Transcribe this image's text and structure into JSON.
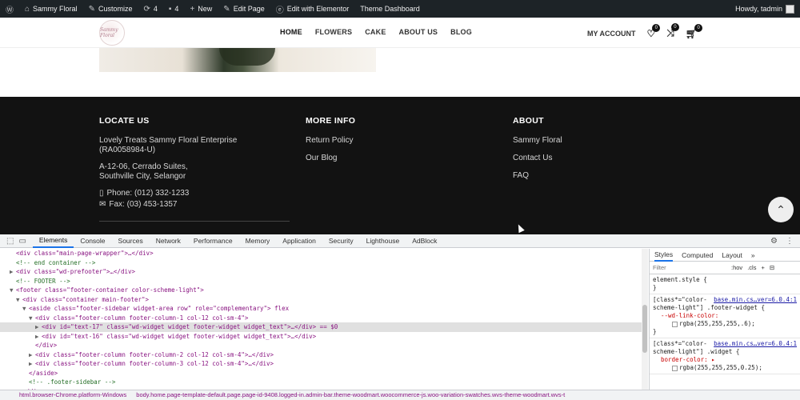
{
  "admin_bar": {
    "site_name": "Sammy Floral",
    "customize": "Customize",
    "updates": "4",
    "comments": "4",
    "new": "New",
    "edit_page": "Edit Page",
    "elementor": "Edit with Elementor",
    "theme_dashboard": "Theme Dashboard",
    "howdy": "Howdy, tadmin"
  },
  "header": {
    "logo_text": "Sammy Floral",
    "nav": [
      "HOME",
      "FLOWERS",
      "CAKE",
      "ABOUT US",
      "BLOG"
    ],
    "my_account": "MY ACCOUNT",
    "wishlist_count": "0",
    "compare_count": "0",
    "cart_count": "0"
  },
  "footer": {
    "locate_title": "LOCATE US",
    "company": "Lovely Treats Sammy Floral Enterprise (RA0058984-U)",
    "address": "A-12-06, Cerrado Suites, Southville City, Selangor",
    "phone": "Phone: (012) 332-1233",
    "fax": "Fax: (03) 453-1357",
    "more_title": "MORE INFO",
    "more_links": [
      "Return Policy",
      "Our Blog"
    ],
    "about_title": "ABOUT",
    "about_links": [
      "Sammy Floral",
      "Contact Us",
      "FAQ"
    ]
  },
  "devtools": {
    "tabs": [
      "Elements",
      "Console",
      "Sources",
      "Network",
      "Performance",
      "Memory",
      "Application",
      "Security",
      "Lighthouse",
      "AdBlock"
    ],
    "active_tab": "Elements",
    "styles_tabs": [
      "Styles",
      "Computed",
      "Layout",
      "»"
    ],
    "filter_placeholder": "Filter",
    "hov": ":hov",
    "cls": ".cls",
    "add": "+",
    "lines": [
      {
        "indent": 2,
        "arrow": "",
        "html": "<div class=\"main-page-wrapper\">…</div>",
        "kind": "tag"
      },
      {
        "indent": 2,
        "arrow": "",
        "html": "<!-- end container -->",
        "kind": "cmt"
      },
      {
        "indent": 2,
        "arrow": "▶",
        "html": "<div class=\"wd-prefooter\">…</div>",
        "kind": "tag"
      },
      {
        "indent": 2,
        "arrow": "",
        "html": "<!-- FOOTER -->",
        "kind": "cmt"
      },
      {
        "indent": 2,
        "arrow": "▼",
        "html": "<footer class=\"footer-container color-scheme-light\">",
        "kind": "tag"
      },
      {
        "indent": 4,
        "arrow": "▼",
        "html": "<div class=\"container main-footer\">",
        "kind": "tag"
      },
      {
        "indent": 6,
        "arrow": "▼",
        "html": "<aside class=\"footer-sidebar widget-area row\" role=\"complementary\"> flex",
        "kind": "tag"
      },
      {
        "indent": 8,
        "arrow": "▼",
        "html": "<div class=\"footer-column footer-column-1 col-12 col-sm-4\">",
        "kind": "tag"
      },
      {
        "indent": 10,
        "arrow": "▶",
        "html": "<div id=\"text-17\" class=\"wd-widget widget footer-widget  widget_text\">…</div> == $0",
        "kind": "tag",
        "selected": true
      },
      {
        "indent": 10,
        "arrow": "▶",
        "html": "<div id=\"text-16\" class=\"wd-widget widget footer-widget  widget_text\">…</div>",
        "kind": "tag"
      },
      {
        "indent": 8,
        "arrow": "",
        "html": "</div>",
        "kind": "tag"
      },
      {
        "indent": 8,
        "arrow": "▶",
        "html": "<div class=\"footer-column footer-column-2 col-12 col-sm-4\">…</div>",
        "kind": "tag"
      },
      {
        "indent": 8,
        "arrow": "▶",
        "html": "<div class=\"footer-column footer-column-3 col-12 col-sm-4\">…</div>",
        "kind": "tag"
      },
      {
        "indent": 6,
        "arrow": "",
        "html": "</aside>",
        "kind": "tag"
      },
      {
        "indent": 6,
        "arrow": "",
        "html": "<!-- .footer-sidebar -->",
        "kind": "cmt"
      },
      {
        "indent": 4,
        "arrow": "",
        "html": "</div>",
        "kind": "tag"
      }
    ],
    "styles": {
      "element_style": "element.style {",
      "close": "}",
      "rule1_sel": "[class*=\"color-scheme-light\"] .footer-widget {",
      "rule1_src": "base.min.cs…ver=6.0.4:1",
      "rule1_prop": "--wd-link-color:",
      "rule1_val": "rgba(255,255,255,.6);",
      "rule2_sel": "[class*=\"color-scheme-light\"] .widget {",
      "rule2_src": "base.min.cs…ver=6.0.4:1",
      "rule2_prop": "border-color: ▸",
      "rule2_val": "rgba(255,255,255,0.25);"
    },
    "breadcrumb": [
      "html.browser-Chrome.platform-Windows",
      "body.home.page-template-default.page.page-id-9408.logged-in.admin-bar.theme-woodmart.woocommerce-js.woo-variation-swatches.wvs-theme-woodmart.wvs-t"
    ]
  }
}
